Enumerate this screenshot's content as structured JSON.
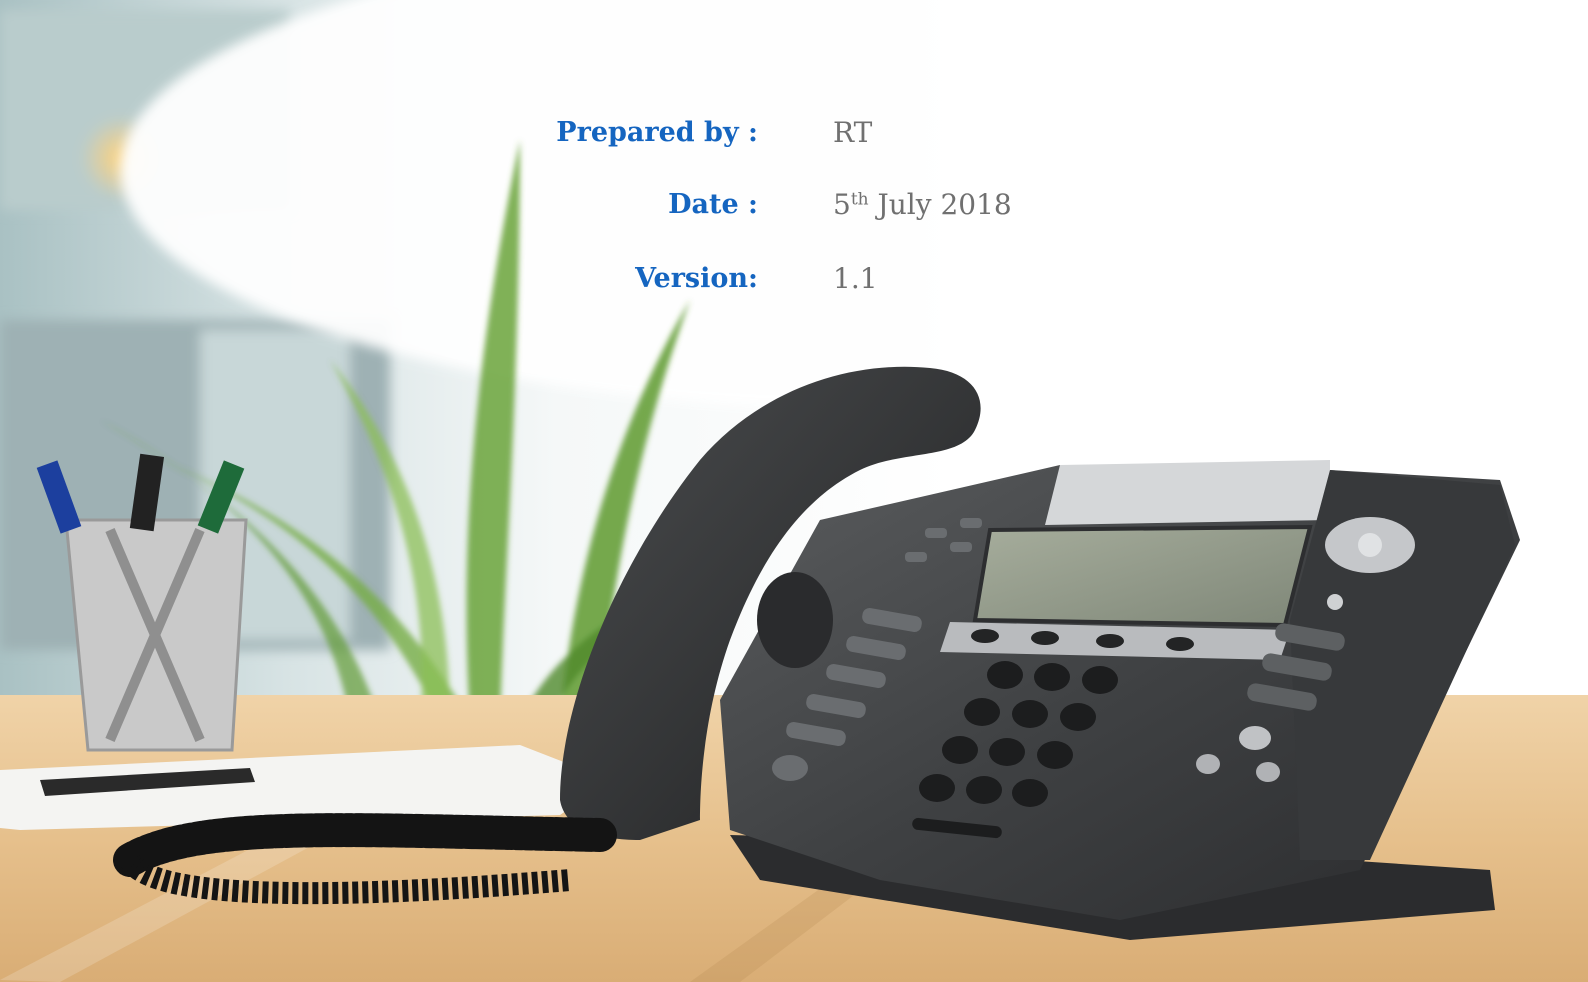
{
  "cover": {
    "prepared_by_label": "Prepared by :",
    "prepared_by_value": "RT",
    "date_label": "Date :",
    "date_day": "5",
    "date_suffix": "th",
    "date_rest": " July 2018",
    "version_label": "Version:",
    "version_value": "1.1"
  },
  "colors": {
    "label": "#1565c0",
    "value": "#707070"
  }
}
